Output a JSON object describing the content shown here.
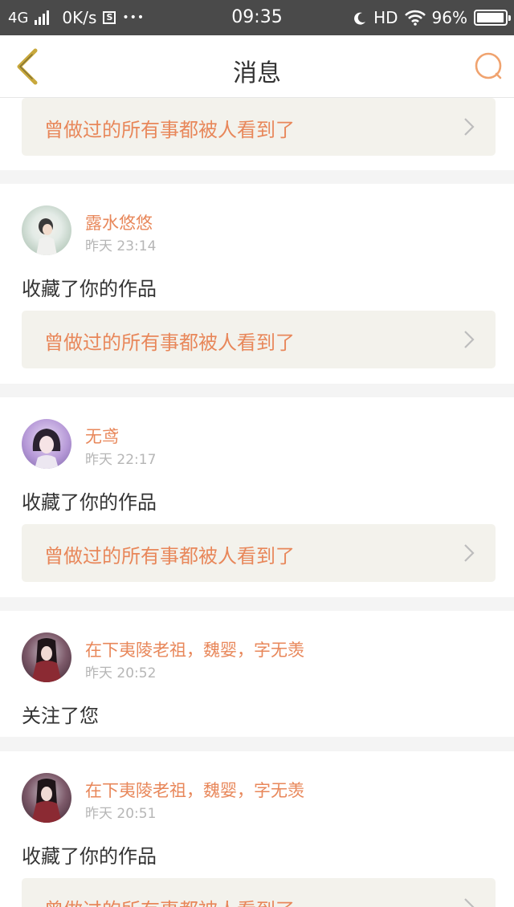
{
  "status_bar": {
    "network": "4G",
    "speed": "0K/s",
    "s_badge": "S",
    "dots": "•••",
    "time": "09:35",
    "hd": "HD",
    "battery": "96%",
    "battery_level": 0.96,
    "icons": [
      "signal-icon",
      "s-badge-icon",
      "more-dots-icon",
      "moon-icon",
      "wifi-icon",
      "battery-icon"
    ]
  },
  "nav": {
    "title": "消息",
    "icons": [
      "back-chevron-icon",
      "search-icon"
    ]
  },
  "colors": {
    "accent": "#e8875a",
    "nav_back": "#c8a83c",
    "status_bar": "#4a4a4a",
    "ref_bg": "#f3f2ec"
  },
  "notifications": [
    {
      "ref_text": "曾做过的所有事都被人看到了"
    },
    {
      "name": "露水悠悠",
      "time": "昨天 23:14",
      "action": "收藏了你的作品",
      "ref_text": "曾做过的所有事都被人看到了"
    },
    {
      "name": "无鸢",
      "time": "昨天 22:17",
      "action": "收藏了你的作品",
      "ref_text": "曾做过的所有事都被人看到了"
    },
    {
      "name": "在下夷陵老祖，魏婴，字无羡",
      "time": "昨天 20:52",
      "action": "关注了您"
    },
    {
      "name": "在下夷陵老祖，魏婴，字无羡",
      "time": "昨天 20:51",
      "action": "收藏了你的作品",
      "ref_text": "曾做过的所有事都被人看到了"
    }
  ]
}
